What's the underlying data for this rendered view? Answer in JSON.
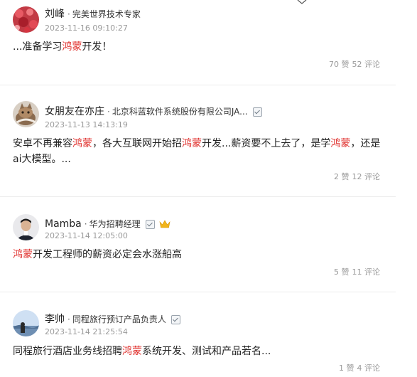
{
  "posts": [
    {
      "name": "刘峰",
      "title": "完美世界技术专家",
      "time": "2023-11-16 09:10:27",
      "content": [
        {
          "text": "...准备学习",
          "hl": false
        },
        {
          "text": "鸿蒙",
          "hl": true
        },
        {
          "text": "开发！",
          "hl": false
        }
      ],
      "likes": "70 赞",
      "comments": "52 评论",
      "verified": false,
      "crown": false,
      "avatar_icon": "red-blossom-avatar"
    },
    {
      "name": "女朋友在亦庄",
      "title": "北京科蓝软件系统股份有限公司JA...",
      "time": "2023-11-13 14:13:19",
      "content": [
        {
          "text": "安卓不再兼容",
          "hl": false
        },
        {
          "text": "鸿蒙",
          "hl": true
        },
        {
          "text": "，各大互联网开始招",
          "hl": false
        },
        {
          "text": "鸿蒙",
          "hl": true
        },
        {
          "text": "开发...薪资要不上去了，是学",
          "hl": false
        },
        {
          "text": "鸿蒙",
          "hl": true
        },
        {
          "text": "，还是ai大模型。...",
          "hl": false
        }
      ],
      "likes": "2 赞",
      "comments": "12 评论",
      "verified": true,
      "crown": false,
      "avatar_icon": "cat-avatar"
    },
    {
      "name": "Mamba",
      "title": "华为招聘经理",
      "time": "2023-11-14 12:05:00",
      "content": [
        {
          "text": "鸿蒙",
          "hl": true
        },
        {
          "text": "开发工程师的薪资必定会水涨船高",
          "hl": false
        }
      ],
      "likes": "5 赞",
      "comments": "11 评论",
      "verified": true,
      "crown": true,
      "avatar_icon": "man-portrait-avatar"
    },
    {
      "name": "李帅",
      "title": "同程旅行预订产品负责人",
      "time": "2023-11-14 21:25:54",
      "content": [
        {
          "text": "同程旅行酒店业务线招聘",
          "hl": false
        },
        {
          "text": "鸿蒙",
          "hl": true
        },
        {
          "text": "系统开发、测试和产品若名...",
          "hl": false
        }
      ],
      "likes": "1 赞",
      "comments": "4 评论",
      "verified": true,
      "crown": false,
      "avatar_icon": "landscape-avatar"
    }
  ],
  "separator": "·",
  "colors": {
    "highlight": "#e0312e",
    "meta_gray": "#9a9a9a",
    "text": "#222222",
    "divider": "#ececec"
  }
}
